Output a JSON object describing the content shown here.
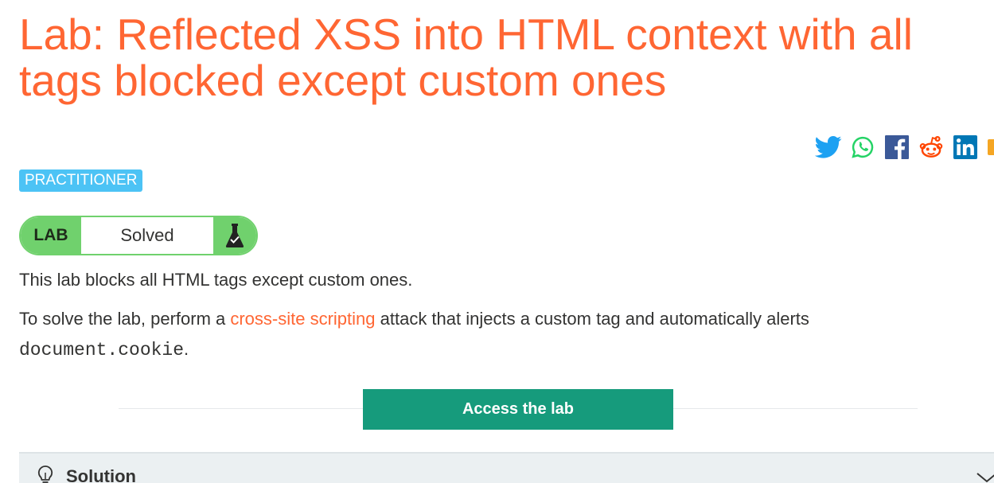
{
  "page": {
    "title_line1": "Lab: Reflected XSS into HTML context with all",
    "title_line2": "tags blocked except custom ones"
  },
  "share_icons": [
    "twitter-icon",
    "whatsapp-icon",
    "facebook-icon",
    "reddit-icon",
    "linkedin-icon",
    "email-icon"
  ],
  "level_badge": "PRACTITIONER",
  "lab_status": {
    "label": "LAB",
    "status": "Solved",
    "icon": "flask-check-icon"
  },
  "description": {
    "p1": "This lab blocks all HTML tags except custom ones.",
    "p2_before": "To solve the lab, perform a ",
    "p2_link": "cross-site scripting",
    "p2_after": " attack that injects a custom tag and automatically alerts",
    "p2_code": "document.cookie",
    "p2_end": "."
  },
  "access_button": "Access the lab",
  "solution": {
    "label": "Solution",
    "icon": "lightbulb-icon",
    "toggle_icon": "chevron-down-icon"
  },
  "colors": {
    "title": "#ff6633",
    "badge": "#4cc3f5",
    "lab_green": "#70d16d",
    "button": "#169b7c",
    "link": "#ff6633"
  }
}
